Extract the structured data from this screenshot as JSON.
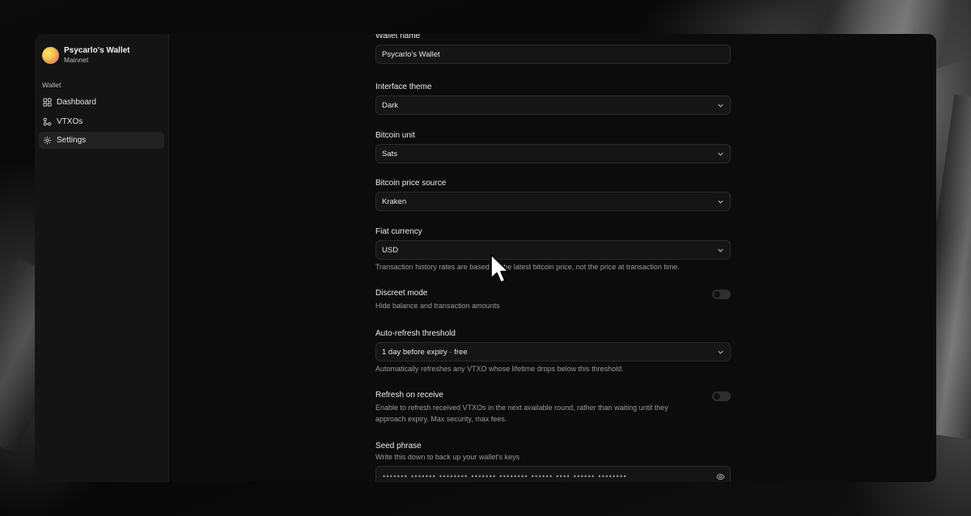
{
  "sidebar": {
    "wallet_name": "Psycarlo's Wallet",
    "network": "Mainnet",
    "section_label": "Wallet",
    "items": [
      {
        "label": "Dashboard",
        "icon": "grid-icon",
        "active": false
      },
      {
        "label": "VTXOs",
        "icon": "nodes-icon",
        "active": false
      },
      {
        "label": "Settings",
        "icon": "gear-icon",
        "active": true
      }
    ]
  },
  "settings": {
    "wallet_name": {
      "label": "Wallet name",
      "value": "Psycarlo's Wallet"
    },
    "interface_theme": {
      "label": "Interface theme",
      "value": "Dark"
    },
    "bitcoin_unit": {
      "label": "Bitcoin unit",
      "value": "Sats"
    },
    "price_source": {
      "label": "Bitcoin price source",
      "value": "Kraken"
    },
    "fiat_currency": {
      "label": "Fiat currency",
      "value": "USD",
      "hint": "Transaction history rates are based on the latest bitcoin price, not the price at transaction time."
    },
    "discreet_mode": {
      "label": "Discreet mode",
      "hint": "Hide balance and transaction amounts",
      "enabled": false
    },
    "auto_refresh": {
      "label": "Auto-refresh threshold",
      "value": "1 day before expiry · free",
      "hint": "Automatically refreshes any VTXO whose lifetime drops below this threshold."
    },
    "refresh_on_receive": {
      "label": "Refresh on receive",
      "hint": "Enable to refresh received VTXOs in the next available round, rather than waiting until they approach expiry. Max security, max fees.",
      "enabled": false
    },
    "seed_phrase": {
      "label": "Seed phrase",
      "hint": "Write this down to back up your wallet's keys",
      "masked": "••••••• ••••••• •••••••• ••••••• •••••••• •••••• •••• •••••• ••••••••"
    }
  }
}
